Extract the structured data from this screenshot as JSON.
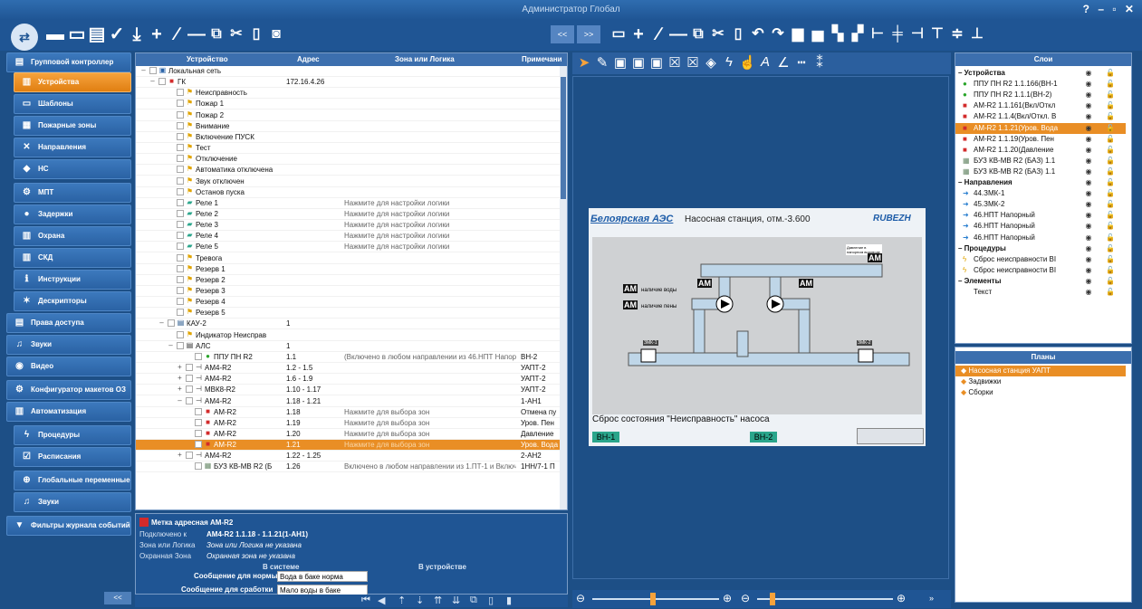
{
  "window": {
    "title": "Администратор Глобал",
    "controls": "? – ▫ ✕"
  },
  "sidebar": {
    "items": [
      {
        "label": "Групповой контроллер",
        "icon": "controller-icon",
        "sub": false,
        "active": false
      },
      {
        "label": "Устройства",
        "icon": "devices-icon",
        "sub": true,
        "active": true
      },
      {
        "label": "Шаблоны",
        "icon": "templates-icon",
        "sub": true,
        "active": false
      },
      {
        "label": "Пожарные зоны",
        "icon": "fire-zones-icon",
        "sub": true,
        "active": false
      },
      {
        "label": "Направления",
        "icon": "directions-icon",
        "sub": true,
        "active": false
      },
      {
        "label": "НС",
        "icon": "pump-station-icon",
        "sub": true,
        "active": false
      },
      {
        "label": "МПТ",
        "icon": "mpt-icon",
        "sub": true,
        "active": false
      },
      {
        "label": "Задержки",
        "icon": "delays-icon",
        "sub": true,
        "active": false
      },
      {
        "label": "Охрана",
        "icon": "guard-icon",
        "sub": true,
        "active": false
      },
      {
        "label": "СКД",
        "icon": "access-control-icon",
        "sub": true,
        "active": false
      },
      {
        "label": "Инструкции",
        "icon": "instructions-icon",
        "sub": true,
        "active": false
      },
      {
        "label": "Дескрипторы",
        "icon": "descriptors-icon",
        "sub": true,
        "active": false
      },
      {
        "label": "Права доступа",
        "icon": "access-rights-icon",
        "sub": false,
        "active": false
      },
      {
        "label": "Звуки",
        "icon": "sounds-icon",
        "sub": false,
        "active": false
      },
      {
        "label": "Видео",
        "icon": "video-icon",
        "sub": false,
        "active": false
      },
      {
        "label": "Конфигуратор макетов ОЗ",
        "icon": "layout-configurator-icon",
        "sub": false,
        "active": false
      },
      {
        "label": "Автоматизация",
        "icon": "automation-icon",
        "sub": false,
        "active": false
      },
      {
        "label": "Процедуры",
        "icon": "procedures-icon",
        "sub": true,
        "active": false
      },
      {
        "label": "Расписания",
        "icon": "schedules-icon",
        "sub": true,
        "active": false
      },
      {
        "label": "Глобальные переменные",
        "icon": "global-vars-icon",
        "sub": true,
        "active": false
      },
      {
        "label": "Звуки",
        "icon": "sounds-icon",
        "sub": true,
        "active": false
      },
      {
        "label": "Фильтры журнала событий",
        "icon": "filter-icon",
        "sub": false,
        "active": false
      }
    ],
    "collapse": "<<"
  },
  "tree": {
    "headers": {
      "device": "Устройство",
      "address": "Адрес",
      "zone": "Зона или Логика",
      "note": "Примечани"
    },
    "rows": [
      {
        "d": 0,
        "t": "–",
        "name": "Локальная сеть",
        "icon": "network",
        "addr": "",
        "zone": "",
        "note": ""
      },
      {
        "d": 1,
        "t": "–",
        "name": "ГК",
        "icon": "gk",
        "addr": "172.16.4.26",
        "zone": "",
        "note": ""
      },
      {
        "d": 3,
        "t": "",
        "name": "Неисправность",
        "icon": "flag",
        "addr": "",
        "zone": "",
        "note": ""
      },
      {
        "d": 3,
        "t": "",
        "name": "Пожар 1",
        "icon": "flag",
        "addr": "",
        "zone": "",
        "note": ""
      },
      {
        "d": 3,
        "t": "",
        "name": "Пожар 2",
        "icon": "flag",
        "addr": "",
        "zone": "",
        "note": ""
      },
      {
        "d": 3,
        "t": "",
        "name": "Внимание",
        "icon": "flag",
        "addr": "",
        "zone": "",
        "note": ""
      },
      {
        "d": 3,
        "t": "",
        "name": "Включение ПУСК",
        "icon": "flag",
        "addr": "",
        "zone": "",
        "note": ""
      },
      {
        "d": 3,
        "t": "",
        "name": "Тест",
        "icon": "flag",
        "addr": "",
        "zone": "",
        "note": ""
      },
      {
        "d": 3,
        "t": "",
        "name": "Отключение",
        "icon": "flag",
        "addr": "",
        "zone": "",
        "note": ""
      },
      {
        "d": 3,
        "t": "",
        "name": "Автоматика отключена",
        "icon": "flag",
        "addr": "",
        "zone": "",
        "note": ""
      },
      {
        "d": 3,
        "t": "",
        "name": "Звук отключен",
        "icon": "flag",
        "addr": "",
        "zone": "",
        "note": ""
      },
      {
        "d": 3,
        "t": "",
        "name": "Останов пуска",
        "icon": "flag",
        "addr": "",
        "zone": "",
        "note": ""
      },
      {
        "d": 3,
        "t": "",
        "name": "Реле 1",
        "icon": "relay",
        "addr": "",
        "zone": "Нажмите для настройки логики",
        "note": ""
      },
      {
        "d": 3,
        "t": "",
        "name": "Реле 2",
        "icon": "relay",
        "addr": "",
        "zone": "Нажмите для настройки логики",
        "note": ""
      },
      {
        "d": 3,
        "t": "",
        "name": "Реле 3",
        "icon": "relay",
        "addr": "",
        "zone": "Нажмите для настройки логики",
        "note": ""
      },
      {
        "d": 3,
        "t": "",
        "name": "Реле 4",
        "icon": "relay",
        "addr": "",
        "zone": "Нажмите для настройки логики",
        "note": ""
      },
      {
        "d": 3,
        "t": "",
        "name": "Реле 5",
        "icon": "relay",
        "addr": "",
        "zone": "Нажмите для настройки логики",
        "note": ""
      },
      {
        "d": 3,
        "t": "",
        "name": "Тревога",
        "icon": "flag",
        "addr": "",
        "zone": "",
        "note": ""
      },
      {
        "d": 3,
        "t": "",
        "name": "Резерв 1",
        "icon": "flag",
        "addr": "",
        "zone": "",
        "note": ""
      },
      {
        "d": 3,
        "t": "",
        "name": "Резерв 2",
        "icon": "flag",
        "addr": "",
        "zone": "",
        "note": ""
      },
      {
        "d": 3,
        "t": "",
        "name": "Резерв 3",
        "icon": "flag",
        "addr": "",
        "zone": "",
        "note": ""
      },
      {
        "d": 3,
        "t": "",
        "name": "Резерв 4",
        "icon": "flag",
        "addr": "",
        "zone": "",
        "note": ""
      },
      {
        "d": 3,
        "t": "",
        "name": "Резерв 5",
        "icon": "flag",
        "addr": "",
        "zone": "",
        "note": ""
      },
      {
        "d": 2,
        "t": "–",
        "name": "КАУ-2",
        "icon": "kau",
        "addr": "1",
        "zone": "",
        "note": ""
      },
      {
        "d": 3,
        "t": "",
        "name": "Индикатор Неисправ",
        "icon": "flag",
        "addr": "",
        "zone": "",
        "note": ""
      },
      {
        "d": 3,
        "t": "–",
        "name": "АЛС",
        "icon": "als",
        "addr": "1",
        "zone": "",
        "note": ""
      },
      {
        "d": 5,
        "t": "",
        "name": "ППУ ПН R2",
        "icon": "green",
        "addr": "1.1",
        "zone": "(Включено в любом направлении из 46.НПТ Напор",
        "note": "ВН-2"
      },
      {
        "d": 4,
        "t": "+",
        "name": "АМ4-R2",
        "icon": "am4",
        "addr": "1.2 - 1.5",
        "zone": "",
        "note": "УАПТ-2"
      },
      {
        "d": 4,
        "t": "+",
        "name": "АМ4-R2",
        "icon": "am4",
        "addr": "1.6 - 1.9",
        "zone": "",
        "note": "УАПТ-2"
      },
      {
        "d": 4,
        "t": "+",
        "name": "МВК8-R2",
        "icon": "am4",
        "addr": "1.10 - 1.17",
        "zone": "",
        "note": "УАПТ-2"
      },
      {
        "d": 4,
        "t": "–",
        "name": "АМ4-R2",
        "icon": "am4",
        "addr": "1.18 - 1.21",
        "zone": "",
        "note": "1-АН1"
      },
      {
        "d": 5,
        "t": "",
        "name": "АМ-R2",
        "icon": "am",
        "addr": "1.18",
        "zone": "Нажмите для выбора зон",
        "note": "Отмена пу"
      },
      {
        "d": 5,
        "t": "",
        "name": "АМ-R2",
        "icon": "am",
        "addr": "1.19",
        "zone": "Нажмите для выбора зон",
        "note": "Уров. Пен"
      },
      {
        "d": 5,
        "t": "",
        "name": "АМ-R2",
        "icon": "am",
        "addr": "1.20",
        "zone": "Нажмите для выбора зон",
        "note": "Давление"
      },
      {
        "d": 5,
        "t": "",
        "name": "АМ-R2",
        "icon": "am",
        "addr": "1.21",
        "zone": "Нажмите для выбора зон",
        "note": "Уров. Вода",
        "sel": true
      },
      {
        "d": 4,
        "t": "+",
        "name": "АМ4-R2",
        "icon": "am4",
        "addr": "1.22 - 1.25",
        "zone": "",
        "note": "2-АН2"
      },
      {
        "d": 5,
        "t": "",
        "name": "БУЗ КВ-МВ R2 (Б",
        "icon": "buz",
        "addr": "1.26",
        "zone": "Включено в любом направлении из 1.ПТ-1 и Включ",
        "note": "1НН/7-1 П"
      }
    ]
  },
  "props": {
    "title": "Метка адресная АМ-R2",
    "connected_label": "Подключено к",
    "connected_value": "АМ4-R2 1.1.18 - 1.1.21(1-АН1)",
    "zone_label": "Зона или Логика",
    "zone_value": "Зона или Логика не указана",
    "guard_label": "Охранная Зона",
    "guard_value": "Охранная зона не указана",
    "col_system": "В системе",
    "col_device": "В устройстве",
    "norm_label": "Сообщение для нормы",
    "norm_value": "Вода в баке норма",
    "trig_label": "Сообщение для сработки",
    "trig_value": "Мало воды в баке"
  },
  "scheme": {
    "station": "Белоярская АЭС",
    "title": "Насосная станция, отм.-3.600",
    "logo": "RUBEZH",
    "pressure_label": "Давление в напорном водоводе",
    "am": "AM",
    "water_label": "наличие воды",
    "foam_label": "наличие пены",
    "valve1": "ЗМК-1",
    "valve2": "ЗМК-2",
    "reset": "Сброс состояния \"Неисправность\" насоса",
    "vn1": "ВН-1",
    "vn2": "ВН-2"
  },
  "layers": {
    "title": "Слои",
    "rows": [
      {
        "g": true,
        "t": "– Устройства"
      },
      {
        "i": "green",
        "t": "ППУ ПН R2 1.1.166(ВН-1"
      },
      {
        "i": "green",
        "t": "ППУ ПН R2 1.1.1(ВН-2)"
      },
      {
        "i": "red",
        "t": "АМ-R2 1.1.161(Вкл/Откл"
      },
      {
        "i": "red",
        "t": "АМ-R2 1.1.4(Вкл/Откл. В"
      },
      {
        "i": "red",
        "t": "АМ-R2 1.1.21(Уров. Вода",
        "sel": true
      },
      {
        "i": "red",
        "t": "АМ-R2 1.1.19(Уров. Пен"
      },
      {
        "i": "red",
        "t": "АМ-R2 1.1.20(Давление"
      },
      {
        "i": "buz",
        "t": "БУЗ КВ-МВ R2 (БАЗ) 1.1"
      },
      {
        "i": "buz",
        "t": "БУЗ КВ-МВ R2 (БАЗ) 1.1"
      },
      {
        "g": true,
        "t": "– Направления"
      },
      {
        "i": "arrow",
        "t": "44.ЗМК-1"
      },
      {
        "i": "arrow",
        "t": "45.ЗМК-2"
      },
      {
        "i": "arrow",
        "t": "46.НПТ Напорный"
      },
      {
        "i": "arrow",
        "t": "46.НПТ Напорный"
      },
      {
        "i": "arrow",
        "t": "46.НПТ Напорный"
      },
      {
        "g": true,
        "t": "– Процедуры"
      },
      {
        "i": "bolt",
        "t": "Сброс неисправности ВІ"
      },
      {
        "i": "bolt",
        "t": "Сброс неисправности ВІ"
      },
      {
        "g": true,
        "t": "– Элементы"
      },
      {
        "i": "",
        "t": "Текст"
      }
    ]
  },
  "plans": {
    "title": "Планы",
    "rows": [
      {
        "t": "Насосная станция УАПТ",
        "sel": true
      },
      {
        "t": "Задвижки",
        "sel": false
      },
      {
        "t": "Сборки",
        "sel": false
      }
    ]
  },
  "colors": {
    "accent": "#e98e25",
    "panel": "#1f5594",
    "header": "#3c6fae"
  }
}
